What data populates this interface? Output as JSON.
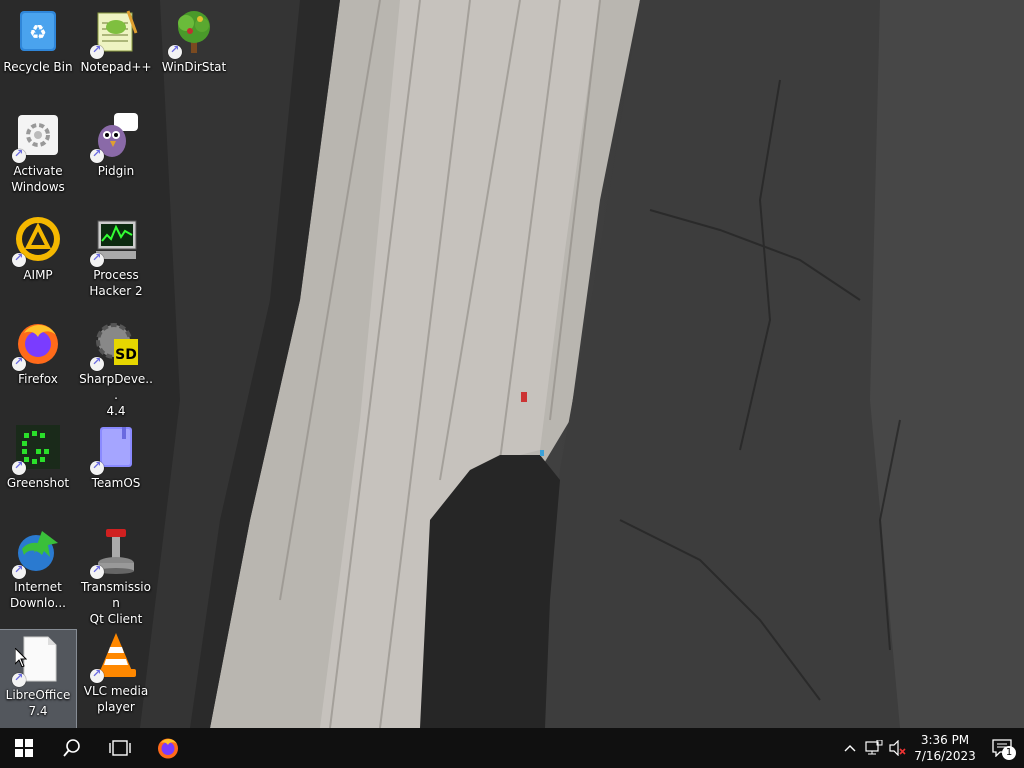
{
  "desktop": {
    "icons": [
      {
        "label": "Recycle Bin",
        "icon": "recycle-bin-icon"
      },
      {
        "label": "Notepad++",
        "icon": "notepad-plus-plus-icon"
      },
      {
        "label": "WinDirStat",
        "icon": "windirstat-icon"
      },
      {
        "label": "Activate\nWindows",
        "icon": "activate-windows-icon"
      },
      {
        "label": "Pidgin",
        "icon": "pidgin-icon"
      },
      {
        "label": "AIMP",
        "icon": "aimp-icon"
      },
      {
        "label": "Process\nHacker 2",
        "icon": "process-hacker-icon"
      },
      {
        "label": "Firefox",
        "icon": "firefox-icon"
      },
      {
        "label": "SharpDeve...\n4.4",
        "icon": "sharpdevelop-icon"
      },
      {
        "label": "Greenshot",
        "icon": "greenshot-icon"
      },
      {
        "label": "TeamOS",
        "icon": "teamos-icon"
      },
      {
        "label": "Internet\nDownlo...",
        "icon": "internet-download-manager-icon"
      },
      {
        "label": "Transmission\nQt Client",
        "icon": "transmission-icon"
      },
      {
        "label": "LibreOffice\n7.4",
        "icon": "libreoffice-icon"
      },
      {
        "label": "VLC media\nplayer",
        "icon": "vlc-icon"
      }
    ],
    "selected": "LibreOffice 7.4"
  },
  "taskbar": {
    "start": "windows-logo-icon",
    "search": "search-icon",
    "task_view": "task-view-icon",
    "pinned": [
      "firefox-icon"
    ],
    "tray": {
      "chevron": "chevron-up-icon",
      "network": "network-disconnected-icon",
      "volume": "volume-muted-icon",
      "time": "3:36 PM",
      "date": "7/16/2023",
      "notifications_count": "1"
    }
  },
  "colors": {
    "taskbar_bg": "#101010",
    "selection": "#bccde1"
  }
}
